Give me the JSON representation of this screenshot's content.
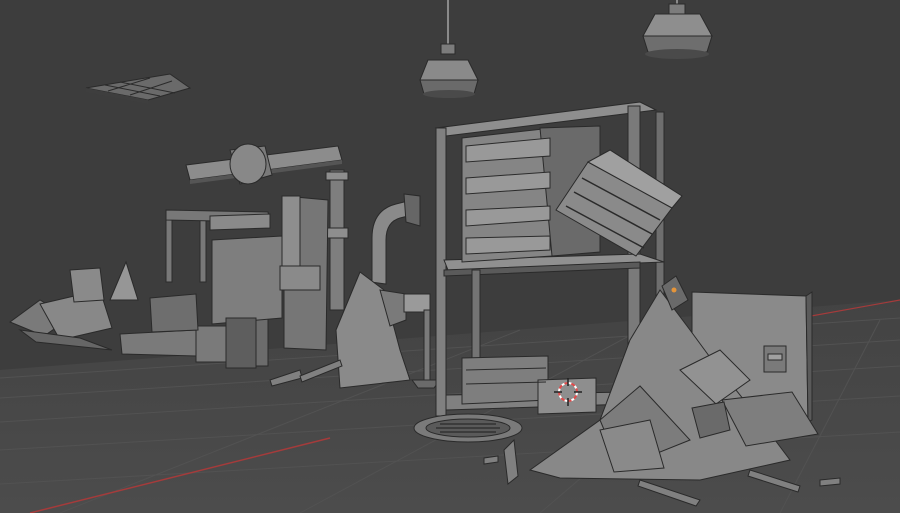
{
  "viewport": {
    "editor": "3d-viewport",
    "view": "perspective",
    "shading": "solid",
    "grid": true,
    "cursor_3d_visible": true,
    "colors": {
      "background": "#3d3d3d",
      "floor": "#4a4a4a",
      "grid_line": "#555555",
      "x_axis": "#a53b3b",
      "mesh_light": "#8e8e8e",
      "mesh_mid": "#6e6e6e",
      "mesh_dark": "#4a4a4a",
      "mesh_edge": "#2a2a2a",
      "cursor_red": "#e24a4a"
    },
    "objects": [
      {
        "name": "ceiling-vent-panel"
      },
      {
        "name": "ceiling-lamp-small"
      },
      {
        "name": "ceiling-lamp-large"
      },
      {
        "name": "horizontal-pipe-with-valve"
      },
      {
        "name": "vertical-curved-pipe"
      },
      {
        "name": "pipe-elbow-vent"
      },
      {
        "name": "generator-machine"
      },
      {
        "name": "metal-shelf-unit"
      },
      {
        "name": "wooden-crate-stack"
      },
      {
        "name": "tilted-crate"
      },
      {
        "name": "wall-panel-with-switch"
      },
      {
        "name": "manhole-cover"
      },
      {
        "name": "broken-crate-debris-pile"
      },
      {
        "name": "small-crate"
      },
      {
        "name": "concrete-debris-left"
      },
      {
        "name": "lamp-post-small"
      },
      {
        "name": "scaffold-frame"
      }
    ]
  }
}
